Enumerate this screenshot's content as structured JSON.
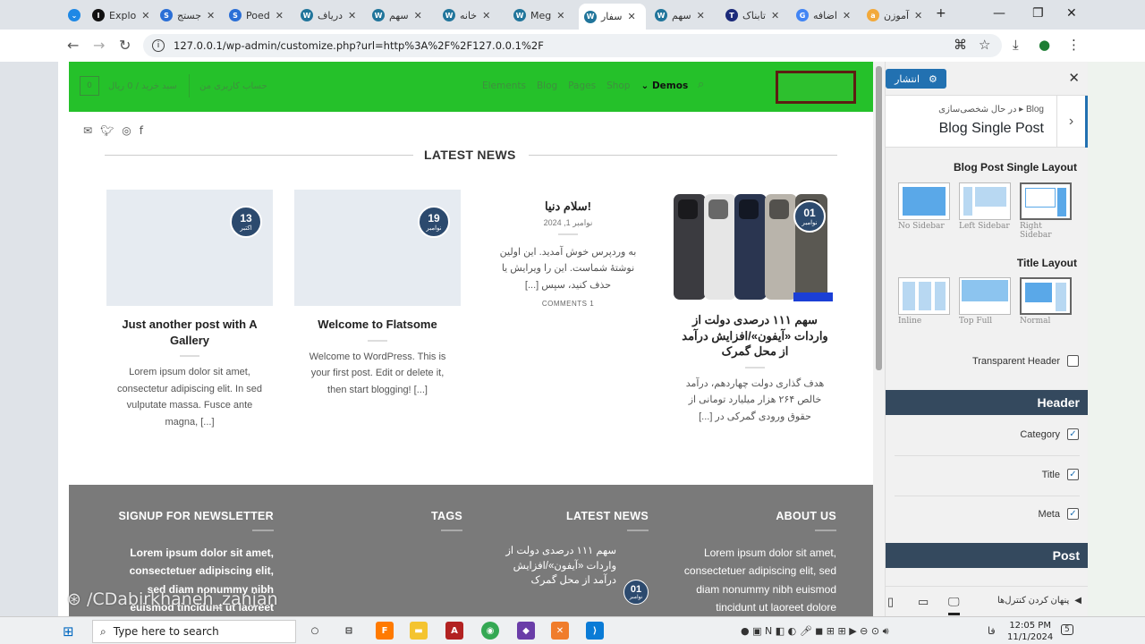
{
  "browser": {
    "tabs": [
      {
        "label": "Explo",
        "fav_color": "#111111",
        "fav_text": "I"
      },
      {
        "label": "جستج",
        "fav_color": "#2b6fd6",
        "fav_text": "S"
      },
      {
        "label": "Poed",
        "fav_color": "#2b6fd6",
        "fav_text": "S"
      },
      {
        "label": "دریاف",
        "fav_color": "#21759b",
        "fav_text": "W"
      },
      {
        "label": "سهم",
        "fav_color": "#21759b",
        "fav_text": "W"
      },
      {
        "label": "خانه",
        "fav_color": "#21759b",
        "fav_text": "W"
      },
      {
        "label": "Meg",
        "fav_color": "#21759b",
        "fav_text": "W"
      },
      {
        "label": "سفار",
        "fav_color": "#21759b",
        "fav_text": "W"
      },
      {
        "label": "سهم",
        "fav_color": "#21759b",
        "fav_text": "W"
      },
      {
        "label": "تابناک",
        "fav_color": "#1b2a7a",
        "fav_text": "T"
      },
      {
        "label": "اضافه",
        "fav_color": "#4285f4",
        "fav_text": "G"
      },
      {
        "label": "آموزن",
        "fav_color": "#f2a93b",
        "fav_text": "a"
      }
    ],
    "url": "127.0.0.1/wp-admin/customize.php?url=http%3A%2F%2F127.0.0.1%2F"
  },
  "site": {
    "header": {
      "cart_count": "0",
      "cart_label": "سبد خرید / 0 ریال",
      "account_label": "حساب کاربری من",
      "menu": [
        "Elements",
        "Blog",
        "Pages",
        "Shop"
      ],
      "menu_demos": "Demos"
    },
    "latest_news_title": "LATEST NEWS",
    "posts": [
      {
        "day": "13",
        "month": "اکتبر",
        "title": "Just another post with A Gallery",
        "excerpt": "Lorem ipsum dolor sit amet, consectetur adipiscing elit. In sed vulputate massa. Fusce ante magna, [...]"
      },
      {
        "day": "19",
        "month": "نوامبر",
        "title": "Welcome to Flatsome",
        "excerpt": "Welcome to WordPress. This is your first post. Edit or delete it, then start blogging! [...]"
      },
      {
        "title": "سلام دنیا!",
        "date": "نوامبر 1, 2024",
        "excerpt": "به وردپرس خوش آمدید. این اولین نوشتهٔ شماست. این را ویرایش یا حذف کنید، سپس [...]",
        "comments": "COMMENTS 1"
      },
      {
        "day": "01",
        "month": "نوامبر",
        "title": "سهم ۱۱۱ درصدی دولت از واردات «آیفون»/افزایش درآمد از محل گمرک",
        "excerpt": "هدف گذاری دولت چهاردهم، درآمد خالص ۲۶۴ هزار میلیارد تومانی از حقوق ورودی گمرکی در [...]"
      }
    ],
    "footer": {
      "newsletter_title": "SIGNUP FOR NEWSLETTER",
      "newsletter_text": "Lorem ipsum dolor sit amet, consectetuer adipiscing elit, sed diam nonummy nibh euismod tincidunt ut laoreet",
      "tags_title": "TAGS",
      "latest_title": "LATEST NEWS",
      "latest_day": "01",
      "latest_month": "نوامبر",
      "latest_text": "سهم ۱۱۱ درصدی دولت از واردات «آیفون»/افزایش درآمد از محل گمرک",
      "about_title": "ABOUT US",
      "about_text": "Lorem ipsum dolor sit amet, consectetuer adipiscing elit, sed diam nonummy nibh euismod tincidunt ut laoreet dolore"
    }
  },
  "watermark": "/CDabirkhaneh_zanjan",
  "customizer": {
    "publish_label": "انتشار",
    "crumb_small": "در حال شخصی‌سازی ▸ Blog",
    "crumb_title": "Blog Single Post",
    "post_layout_label": "Blog Post Single Layout",
    "post_layouts": [
      "No Sidebar",
      "Left Sidebar",
      "Right Sidebar"
    ],
    "title_layout_label": "Title Layout",
    "title_layouts": [
      "Inline",
      "Top Full",
      "Normal"
    ],
    "transparent_header_label": "Transparent Header",
    "header_section": "Header",
    "category_label": "Category",
    "title_label": "Title",
    "meta_label": "Meta",
    "post_section": "Post",
    "hide_controls_label": "پنهان کردن کنترل‌ها"
  },
  "taskbar": {
    "search_placeholder": "Type here to search",
    "lang": "فا",
    "time": "12:05 PM",
    "date": "11/1/2024",
    "notifications": "5"
  }
}
